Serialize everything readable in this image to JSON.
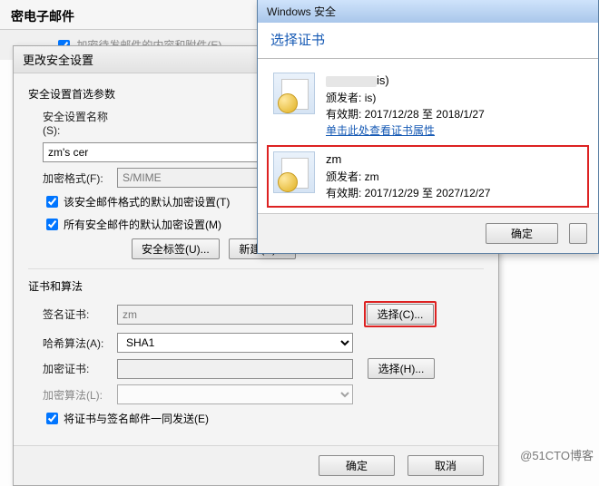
{
  "parent": {
    "title": "密电子邮件",
    "encrypt_attachments_label": "加密待发邮件的内容和附件(E)"
  },
  "settings": {
    "title": "更改安全设置",
    "pref_header": "安全设置首选参数",
    "name_label": "安全设置名称(S):",
    "name_value": "zm's cer",
    "crypt_format_label": "加密格式(F):",
    "crypt_format_value": "S/MIME",
    "chk_default_format": "该安全邮件格式的默认加密设置(T)",
    "chk_default_all": "所有安全邮件的默认加密设置(M)",
    "btn_labels": "安全标签(U)...",
    "btn_new": "新建(N)...",
    "cert_header": "证书和算法",
    "sign_cert_label": "签名证书:",
    "sign_cert_value": "zm",
    "btn_choose_c": "选择(C)...",
    "hash_label": "哈希算法(A):",
    "hash_value": "SHA1",
    "enc_cert_label": "加密证书:",
    "btn_choose_h": "选择(H)...",
    "enc_algo_label": "加密算法(L):",
    "chk_send_with_sign": "将证书与签名邮件一同发送(E)",
    "btn_ok": "确定",
    "btn_cancel": "取消"
  },
  "ws": {
    "titlebar": "Windows 安全",
    "heading": "选择证书",
    "certs": [
      {
        "name_suffix": "is)",
        "issuer_label": "颁发者:",
        "issuer_suffix": "is)",
        "valid_label": "有效期: 2017/12/28 至 2018/1/27",
        "link": "单击此处查看证书属性"
      },
      {
        "name": "zm",
        "issuer_label": "颁发者: zm",
        "valid_label": "有效期: 2017/12/29 至 2027/12/27"
      }
    ],
    "btn_ok": "确定"
  },
  "watermark": "@51CTO博客"
}
